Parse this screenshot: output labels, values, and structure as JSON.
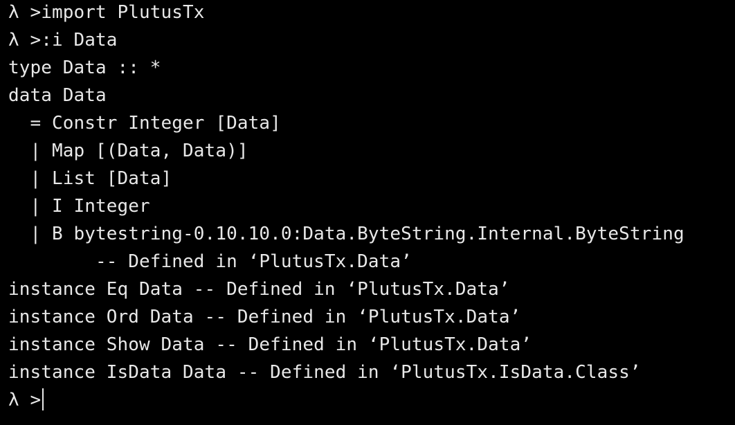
{
  "terminal": {
    "background": "#000000",
    "foreground": "#e8e8e8",
    "lines": [
      "λ >import PlutusTx",
      "λ >:i Data",
      "type Data :: *",
      "data Data",
      "  = Constr Integer [Data]",
      "  | Map [(Data, Data)]",
      "  | List [Data]",
      "  | I Integer",
      "  | B bytestring-0.10.10.0:Data.ByteString.Internal.ByteString",
      "        -- Defined in ‘PlutusTx.Data’",
      "instance Eq Data -- Defined in ‘PlutusTx.Data’",
      "instance Ord Data -- Defined in ‘PlutusTx.Data’",
      "instance Show Data -- Defined in ‘PlutusTx.Data’",
      "instance IsData Data -- Defined in ‘PlutusTx.IsData.Class’"
    ],
    "prompt": "λ >"
  }
}
